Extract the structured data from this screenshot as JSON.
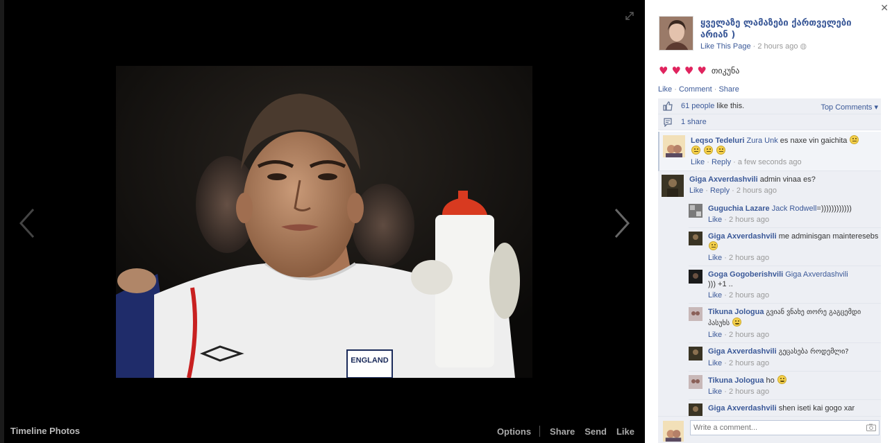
{
  "stage": {
    "album_label": "Timeline Photos",
    "actions": [
      "Options",
      "Share",
      "Send",
      "Like"
    ]
  },
  "photo": {
    "shirt_text": "ENGLAND"
  },
  "panel": {
    "page_name": "ყველაზე ლამაზები ქართველები არიან )",
    "like_page": "Like This Page",
    "time": "2 hours ago",
    "caption": "თიკუნა",
    "hearts": 4,
    "post_actions": {
      "like": "Like",
      "comment": "Comment",
      "share": "Share"
    },
    "likes_count": "61 people",
    "likes_suffix": "like this.",
    "top_comments": "Top Comments",
    "shares": "1 share",
    "comment_placeholder": "Write a comment..."
  },
  "comments": [
    {
      "name": "Leqso Tedeluri",
      "tag": "Zura Unk",
      "text": "es naxe vin gaichita",
      "meta_like": "Like",
      "meta_reply": "Reply",
      "time": "a few seconds ago"
    },
    {
      "name": "Giga Axverdashvili",
      "tag": "",
      "text": "admin vinaa es?",
      "meta_like": "Like",
      "meta_reply": "Reply",
      "time": "2 hours ago"
    }
  ],
  "replies": [
    {
      "name": "Guguchia Lazare",
      "tag": "Jack Rodwell",
      "text": "=))))))))))))",
      "like": "Like",
      "time": "2 hours ago"
    },
    {
      "name": "Giga Axverdashvili",
      "tag": "",
      "text": "me adminisgan mainteresebs",
      "like": "Like",
      "time": "2 hours ago"
    },
    {
      "name": "Goga Gogoberishvili",
      "tag": "Giga Axverdashvili",
      "text": "))) +1 ..",
      "like": "Like",
      "time": "2 hours ago"
    },
    {
      "name": "Tikuna Jologua",
      "tag": "",
      "text": "გვიან ვნახე თორე გაგცემდი პასუხს",
      "like": "Like",
      "time": "2 hours ago"
    },
    {
      "name": "Giga Axverdashvili",
      "tag": "",
      "text": "გეცასება როდემლი?",
      "like": "Like",
      "time": "2 hours ago"
    },
    {
      "name": "Tikuna Jologua",
      "tag": "",
      "text": "ho",
      "like": "Like",
      "time": "2 hours ago"
    },
    {
      "name": "Giga Axverdashvili",
      "tag": "",
      "text": "shen iseti kai gogo xar",
      "like": "Like",
      "time": ""
    }
  ],
  "colors": {
    "link": "#3b5998",
    "panel_bg": "#edeff4",
    "stage_bg": "#000000"
  }
}
